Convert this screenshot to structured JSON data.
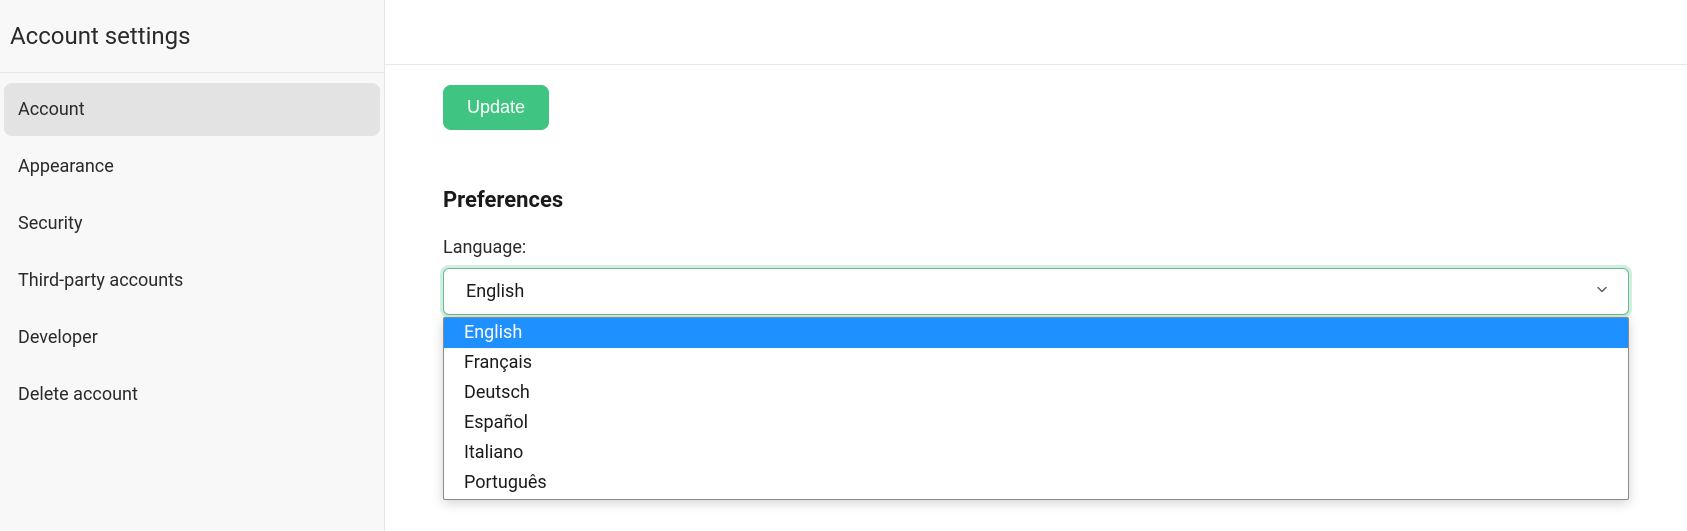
{
  "sidebar": {
    "title": "Account settings",
    "items": [
      {
        "label": "Account",
        "active": true
      },
      {
        "label": "Appearance",
        "active": false
      },
      {
        "label": "Security",
        "active": false
      },
      {
        "label": "Third-party accounts",
        "active": false
      },
      {
        "label": "Developer",
        "active": false
      },
      {
        "label": "Delete account",
        "active": false
      }
    ]
  },
  "main": {
    "update_label": "Update",
    "preferences_heading": "Preferences",
    "language_label": "Language:",
    "language_selected": "English",
    "language_options": [
      {
        "label": "English",
        "highlighted": true
      },
      {
        "label": "Français",
        "highlighted": false
      },
      {
        "label": "Deutsch",
        "highlighted": false
      },
      {
        "label": "Español",
        "highlighted": false
      },
      {
        "label": "Italiano",
        "highlighted": false
      },
      {
        "label": "Português",
        "highlighted": false
      }
    ]
  }
}
